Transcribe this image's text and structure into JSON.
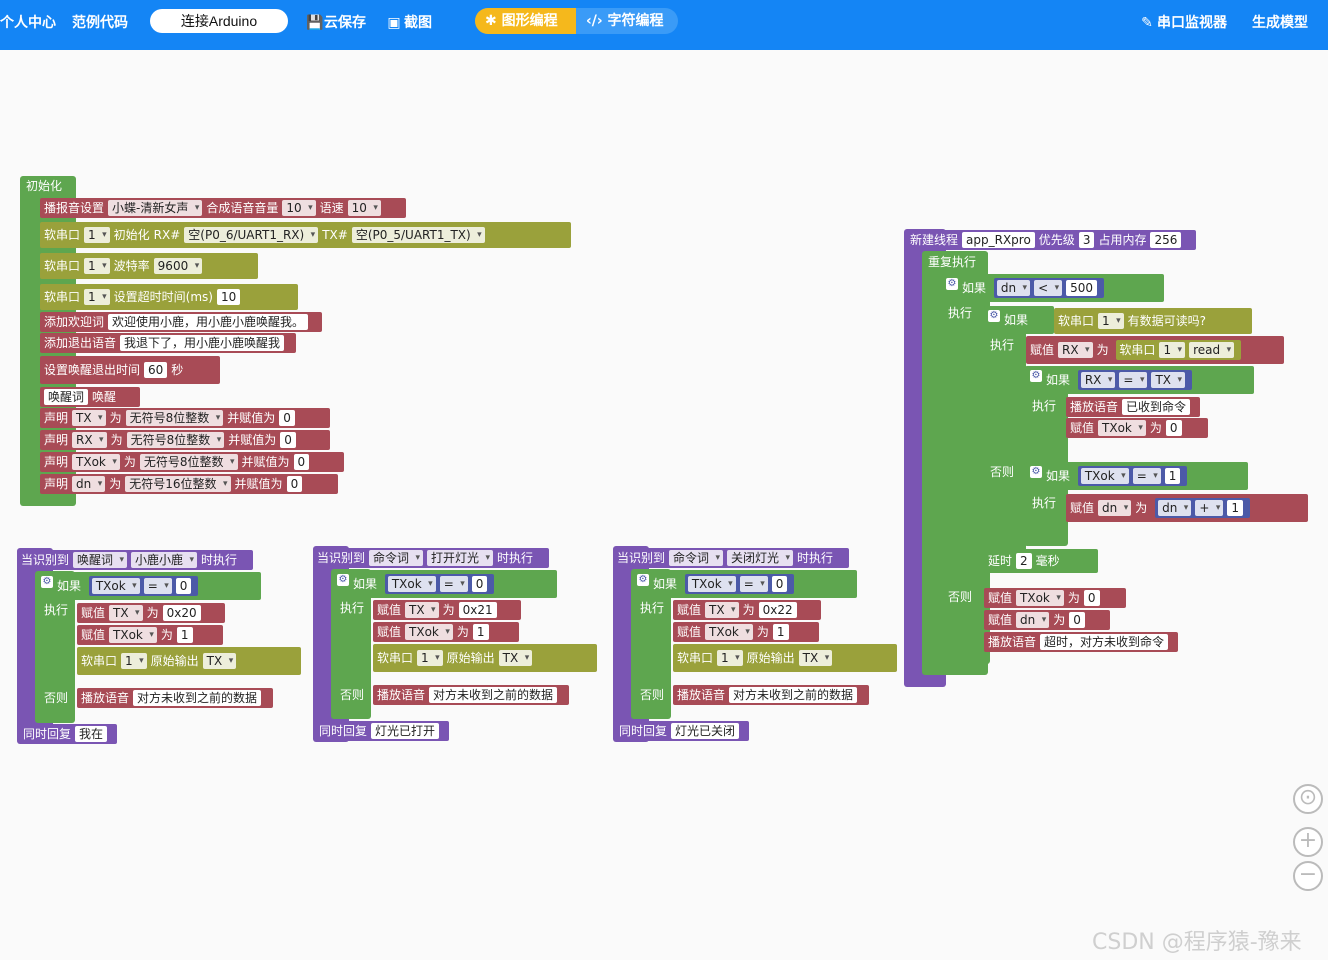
{
  "topbar": {
    "personal": "个人中心",
    "examples": "范例代码",
    "connect": "连接Arduino",
    "cloud_save": "云保存",
    "screenshot": "截图",
    "mode_graph": "图形编程",
    "mode_text": "字符编程",
    "serial_monitor": "串口监视器",
    "gen_model": "生成模型"
  },
  "init_block": {
    "title": "初始化",
    "r1": [
      "播报音设置",
      "小蝶-清新女声",
      "合成语音音量",
      "10",
      "语速",
      "10"
    ],
    "r2": [
      "软串口",
      "1",
      "初始化",
      "RX#",
      "空(P0_6/UART1_RX)",
      "TX#",
      "空(P0_5/UART1_TX)"
    ],
    "r3": [
      "软串口",
      "1",
      "波特率",
      "9600"
    ],
    "r4": [
      "软串口",
      "1",
      "设置超时时间(ms)",
      "10"
    ],
    "r5": [
      "添加欢迎词",
      "欢迎使用小鹿，用小鹿小鹿唤醒我。"
    ],
    "r6": [
      "添加退出语音",
      "我退下了，用小鹿小鹿唤醒我"
    ],
    "r7": [
      "设置唤醒退出时间",
      "60",
      "秒"
    ],
    "r8": [
      "唤醒词",
      "唤醒"
    ],
    "r9": [
      "声明",
      "TX",
      "为",
      "无符号8位整数",
      "并赋值为",
      "0"
    ],
    "r10": [
      "声明",
      "RX",
      "为",
      "无符号8位整数",
      "并赋值为",
      "0"
    ],
    "r11": [
      "声明",
      "TXok",
      "为",
      "无符号8位整数",
      "并赋值为",
      "0"
    ],
    "r12": [
      "声明",
      "dn",
      "为",
      "无符号16位整数",
      "并赋值为",
      "0"
    ]
  },
  "wake_block": {
    "head": [
      "当识别到",
      "唤醒词",
      "小鹿小鹿",
      "时执行"
    ],
    "if": "如果",
    "cond": [
      "TXok",
      "=",
      "0"
    ],
    "exec": "执行",
    "a1": [
      "赋值",
      "TX",
      "为",
      "0x20"
    ],
    "a2": [
      "赋值",
      "TXok",
      "为",
      "1"
    ],
    "a3": [
      "软串口",
      "1",
      "原始输出",
      "TX"
    ],
    "else": "否则",
    "play": [
      "播放语音",
      "对方未收到之前的数据"
    ],
    "reply": [
      "同时回复",
      "我在"
    ]
  },
  "cmd1_block": {
    "head": [
      "当识别到",
      "命令词",
      "打开灯光",
      "时执行"
    ],
    "if": "如果",
    "cond": [
      "TXok",
      "=",
      "0"
    ],
    "exec": "执行",
    "a1": [
      "赋值",
      "TX",
      "为",
      "0x21"
    ],
    "a2": [
      "赋值",
      "TXok",
      "为",
      "1"
    ],
    "a3": [
      "软串口",
      "1",
      "原始输出",
      "TX"
    ],
    "else": "否则",
    "play": [
      "播放语音",
      "对方未收到之前的数据"
    ],
    "reply": [
      "同时回复",
      "灯光已打开"
    ]
  },
  "cmd2_block": {
    "head": [
      "当识别到",
      "命令词",
      "关闭灯光",
      "时执行"
    ],
    "if": "如果",
    "cond": [
      "TXok",
      "=",
      "0"
    ],
    "exec": "执行",
    "a1": [
      "赋值",
      "TX",
      "为",
      "0x22"
    ],
    "a2": [
      "赋值",
      "TXok",
      "为",
      "1"
    ],
    "a3": [
      "软串口",
      "1",
      "原始输出",
      "TX"
    ],
    "else": "否则",
    "play": [
      "播放语音",
      "对方未收到之前的数据"
    ],
    "reply": [
      "同时回复",
      "灯光已关闭"
    ]
  },
  "thread_block": {
    "head": [
      "新建线程",
      "app_RXpro",
      "优先级",
      "3",
      "占用内存",
      "256"
    ],
    "repeat": "重复执行",
    "if1": [
      "如果",
      "dn",
      "<",
      "500"
    ],
    "exec": "执行",
    "if2": [
      "如果",
      "软串口",
      "1",
      "有数据可读吗?"
    ],
    "assign_rx": [
      "赋值",
      "RX",
      "为",
      "软串口",
      "1",
      "read"
    ],
    "if3": [
      "如果",
      "RX",
      "=",
      "TX"
    ],
    "play_ok": [
      "播放语音",
      "已收到命令"
    ],
    "set_txok0": [
      "赋值",
      "TXok",
      "为",
      "0"
    ],
    "else": "否则",
    "if4": [
      "如果",
      "TXok",
      "=",
      "1"
    ],
    "inc_dn": [
      "赋值",
      "dn",
      "为",
      "dn",
      "+",
      "1"
    ],
    "delay": [
      "延时",
      "2",
      "毫秒"
    ],
    "else2": [
      "赋值",
      "TXok",
      "为",
      "0"
    ],
    "else3": [
      "赋值",
      "dn",
      "为",
      "0"
    ],
    "timeout": [
      "播放语音",
      "超时，对方未收到命令"
    ]
  },
  "watermark": "CSDN @程序猿-豫来"
}
